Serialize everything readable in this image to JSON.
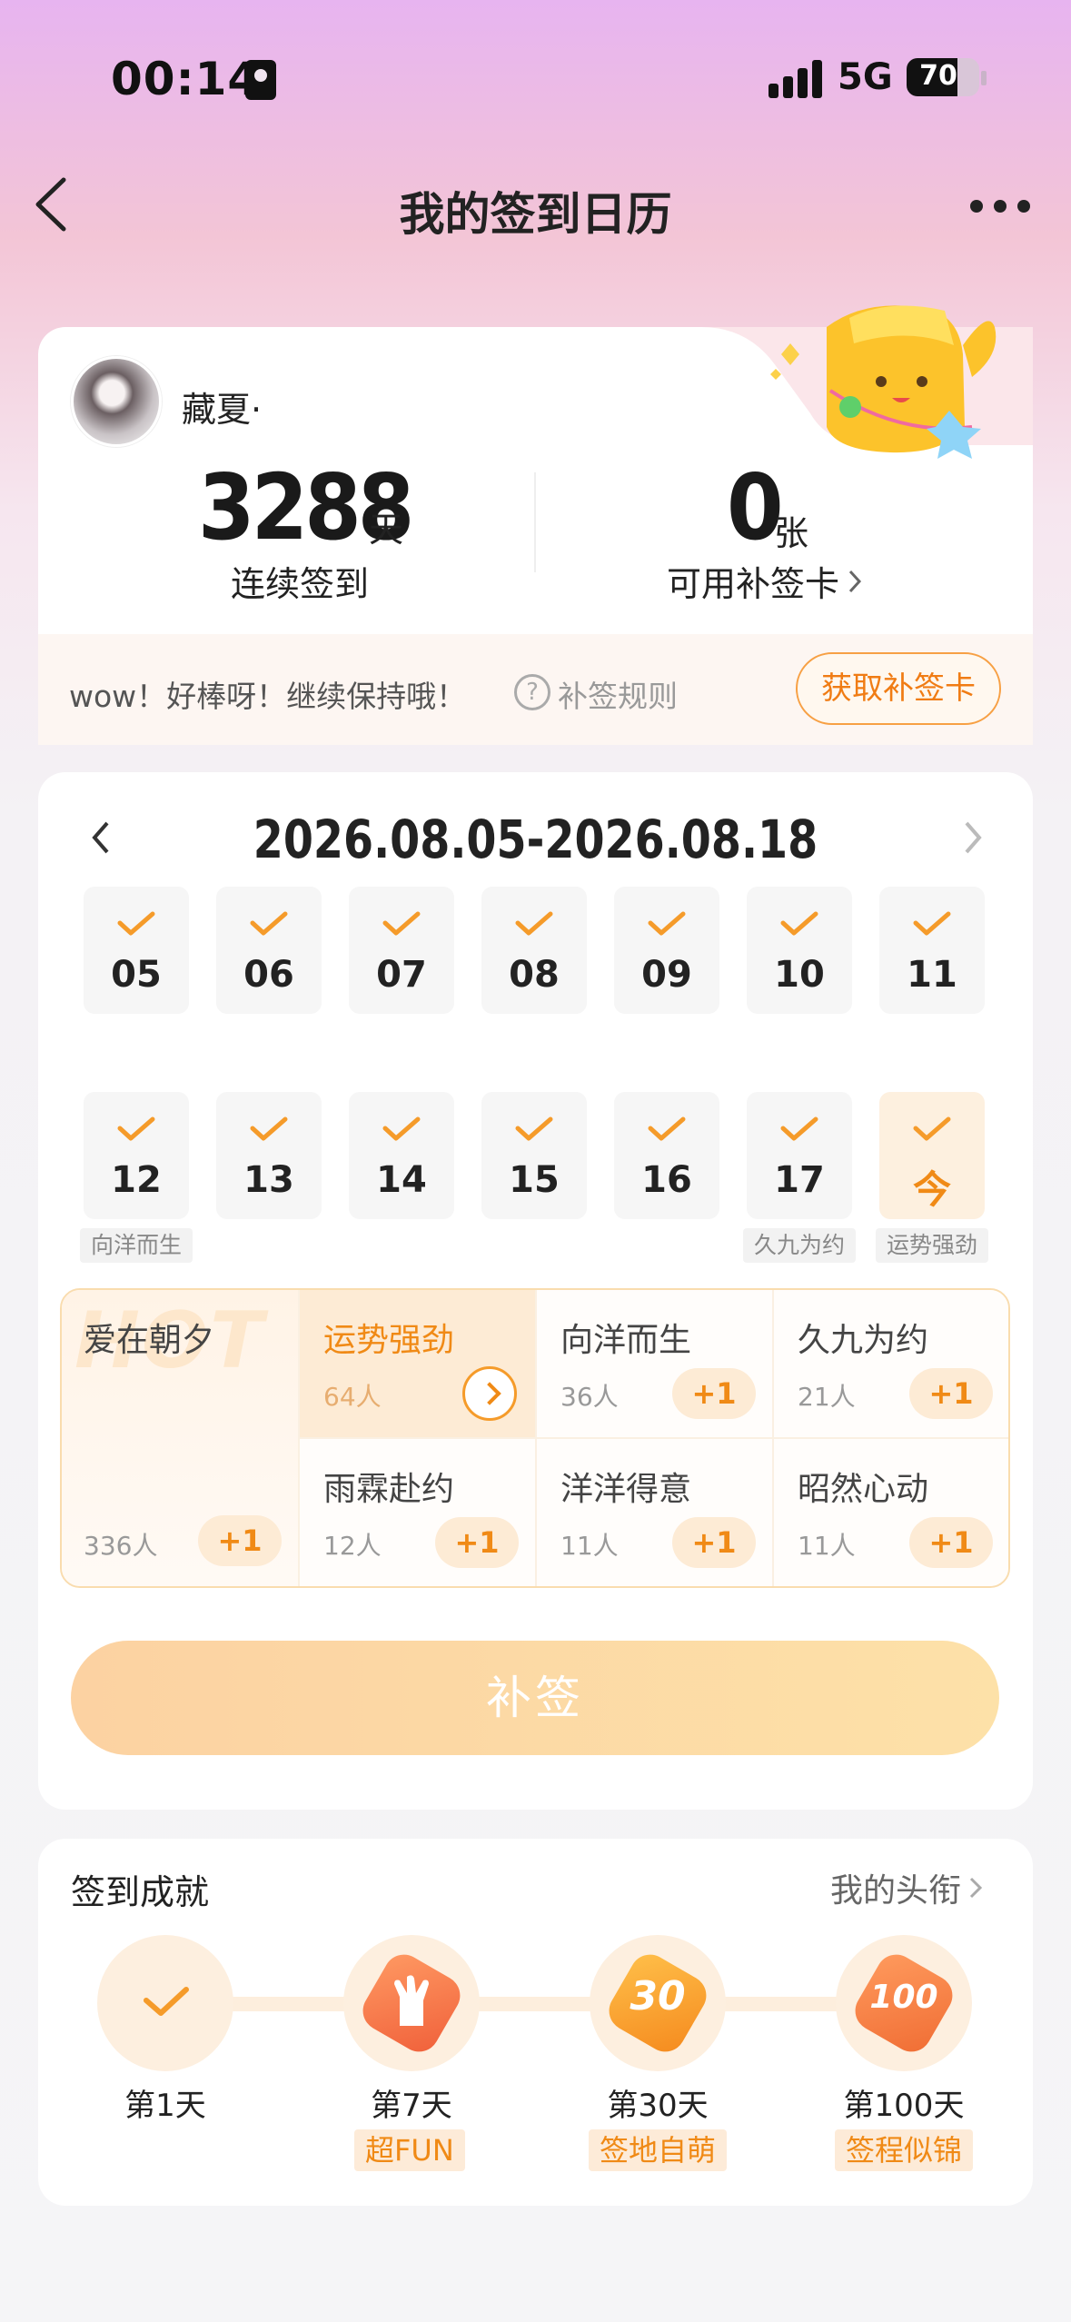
{
  "status_bar": {
    "time": "00:14",
    "network": "5G",
    "battery": "70",
    "battery_level": 0.7
  },
  "header": {
    "title": "我的签到日历"
  },
  "profile": {
    "username": "藏夏·",
    "streak_value": "3288",
    "streak_unit": "天",
    "streak_label": "连续签到",
    "cards_value": "0",
    "cards_unit": "张",
    "cards_label": "可用补签卡",
    "tip": "wow！好棒呀！继续保持哦！",
    "rules_label": "补签规则",
    "get_card_label": "获取补签卡"
  },
  "calendar": {
    "range": "2026.08.05-2026.08.18",
    "row1": [
      {
        "day": "05"
      },
      {
        "day": "06"
      },
      {
        "day": "07"
      },
      {
        "day": "08"
      },
      {
        "day": "09"
      },
      {
        "day": "10"
      },
      {
        "day": "11"
      }
    ],
    "row2": [
      {
        "day": "12",
        "tag": "向洋而生"
      },
      {
        "day": "13"
      },
      {
        "day": "14"
      },
      {
        "day": "15"
      },
      {
        "day": "16"
      },
      {
        "day": "17",
        "tag": "久九为约"
      },
      {
        "day": "今",
        "tag": "运势强劲"
      }
    ]
  },
  "themes": {
    "hot_label": "HOT",
    "first": {
      "name": "爱在朝夕",
      "count": "336人",
      "plus": "+1"
    },
    "items": [
      {
        "name": "运势强劲",
        "count": "64人"
      },
      {
        "name": "向洋而生",
        "count": "36人",
        "plus": "+1"
      },
      {
        "name": "久九为约",
        "count": "21人",
        "plus": "+1"
      },
      {
        "name": "雨霖赴约",
        "count": "12人",
        "plus": "+1"
      },
      {
        "name": "洋洋得意",
        "count": "11人",
        "plus": "+1"
      },
      {
        "name": "昭然心动",
        "count": "11人",
        "plus": "+1"
      }
    ]
  },
  "makeup_button": "补签",
  "achievements": {
    "title": "签到成就",
    "more": "我的头衔",
    "items": [
      {
        "day": "第1天",
        "tag": ""
      },
      {
        "day": "第7天",
        "tag": "超FUN"
      },
      {
        "day": "第30天",
        "tag": "签地自萌",
        "badge": "30"
      },
      {
        "day": "第100天",
        "tag": "签程似锦",
        "badge": "100"
      }
    ]
  }
}
